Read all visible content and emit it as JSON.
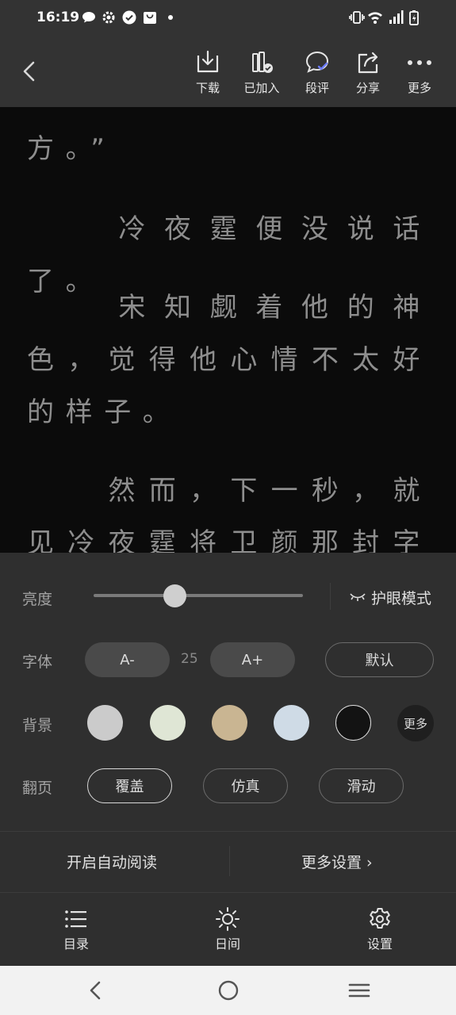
{
  "status_bar": {
    "time": "16:19",
    "left_icons": [
      "chat-bubble-icon",
      "gear-icon",
      "check-circle-icon",
      "shopping-bag-icon",
      "dot-icon"
    ],
    "right_icons": [
      "vibrate-icon",
      "wifi-icon",
      "signal-icon",
      "battery-charging-icon"
    ]
  },
  "toolbar": {
    "back_icon": "back-arrow-icon",
    "actions": [
      {
        "label": "下载",
        "icon": "download-icon"
      },
      {
        "label": "已加入",
        "icon": "bookshelf-added-icon"
      },
      {
        "label": "段评",
        "icon": "comment-icon"
      },
      {
        "label": "分享",
        "icon": "share-icon"
      },
      {
        "label": "更多",
        "icon": "more-dots-icon"
      }
    ]
  },
  "reader": {
    "paragraphs": [
      "方。”",
      "　　冷夜霆便没说话了。",
      "　　宋知觑着他的神色，觉得他心情不太好的样子。",
      "　　然而，下一秒，就见冷夜霆将卫颜那封字迹工"
    ]
  },
  "settings": {
    "brightness": {
      "label": "亮度",
      "level": 0.39,
      "eye_mode_label": "护眼模式"
    },
    "font": {
      "label": "字体",
      "decrease": "A-",
      "size": "25",
      "increase": "A+",
      "default": "默认"
    },
    "background": {
      "label": "背景",
      "swatches": [
        "#cbcbcb",
        "#dfe6d5",
        "#c9b592",
        "#cfdbe6",
        "#131313"
      ],
      "selected_index": 4,
      "more": "更多"
    },
    "page_turn": {
      "label": "翻页",
      "options": [
        "覆盖",
        "仿真",
        "滑动"
      ],
      "selected_index": 0
    },
    "auto_read": "开启自动阅读",
    "more_settings": "更多设置 ›"
  },
  "bottom_nav": [
    {
      "label": "目录",
      "icon": "list-icon"
    },
    {
      "label": "日间",
      "icon": "sun-icon"
    },
    {
      "label": "设置",
      "icon": "settings-gear-icon"
    }
  ],
  "system_nav": [
    "back-chevron-icon",
    "home-circle-icon",
    "menu-lines-icon"
  ]
}
